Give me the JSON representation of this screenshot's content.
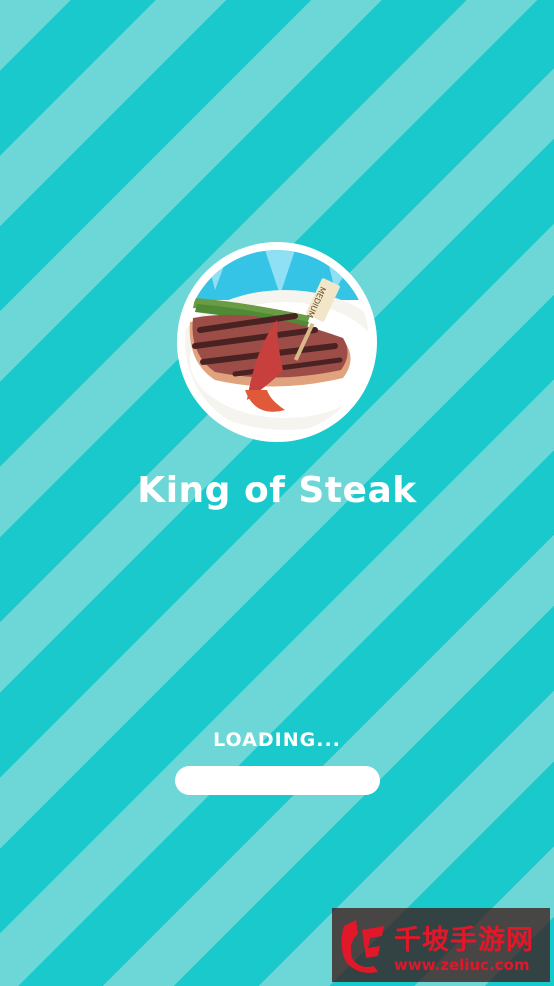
{
  "splash": {
    "title": "King of Steak",
    "icon": "steak-plate-icon",
    "steak_flag_text": "MEDIUM"
  },
  "loading": {
    "label": "LOADING...",
    "progress": 0
  },
  "watermark": {
    "name": "千坡手游网",
    "url": "www.zeliuc.com"
  },
  "colors": {
    "stripe_light": "#6dd7d7",
    "stripe_dark": "#1ac9cb",
    "text": "#ffffff",
    "watermark_red": "#e0182a"
  }
}
